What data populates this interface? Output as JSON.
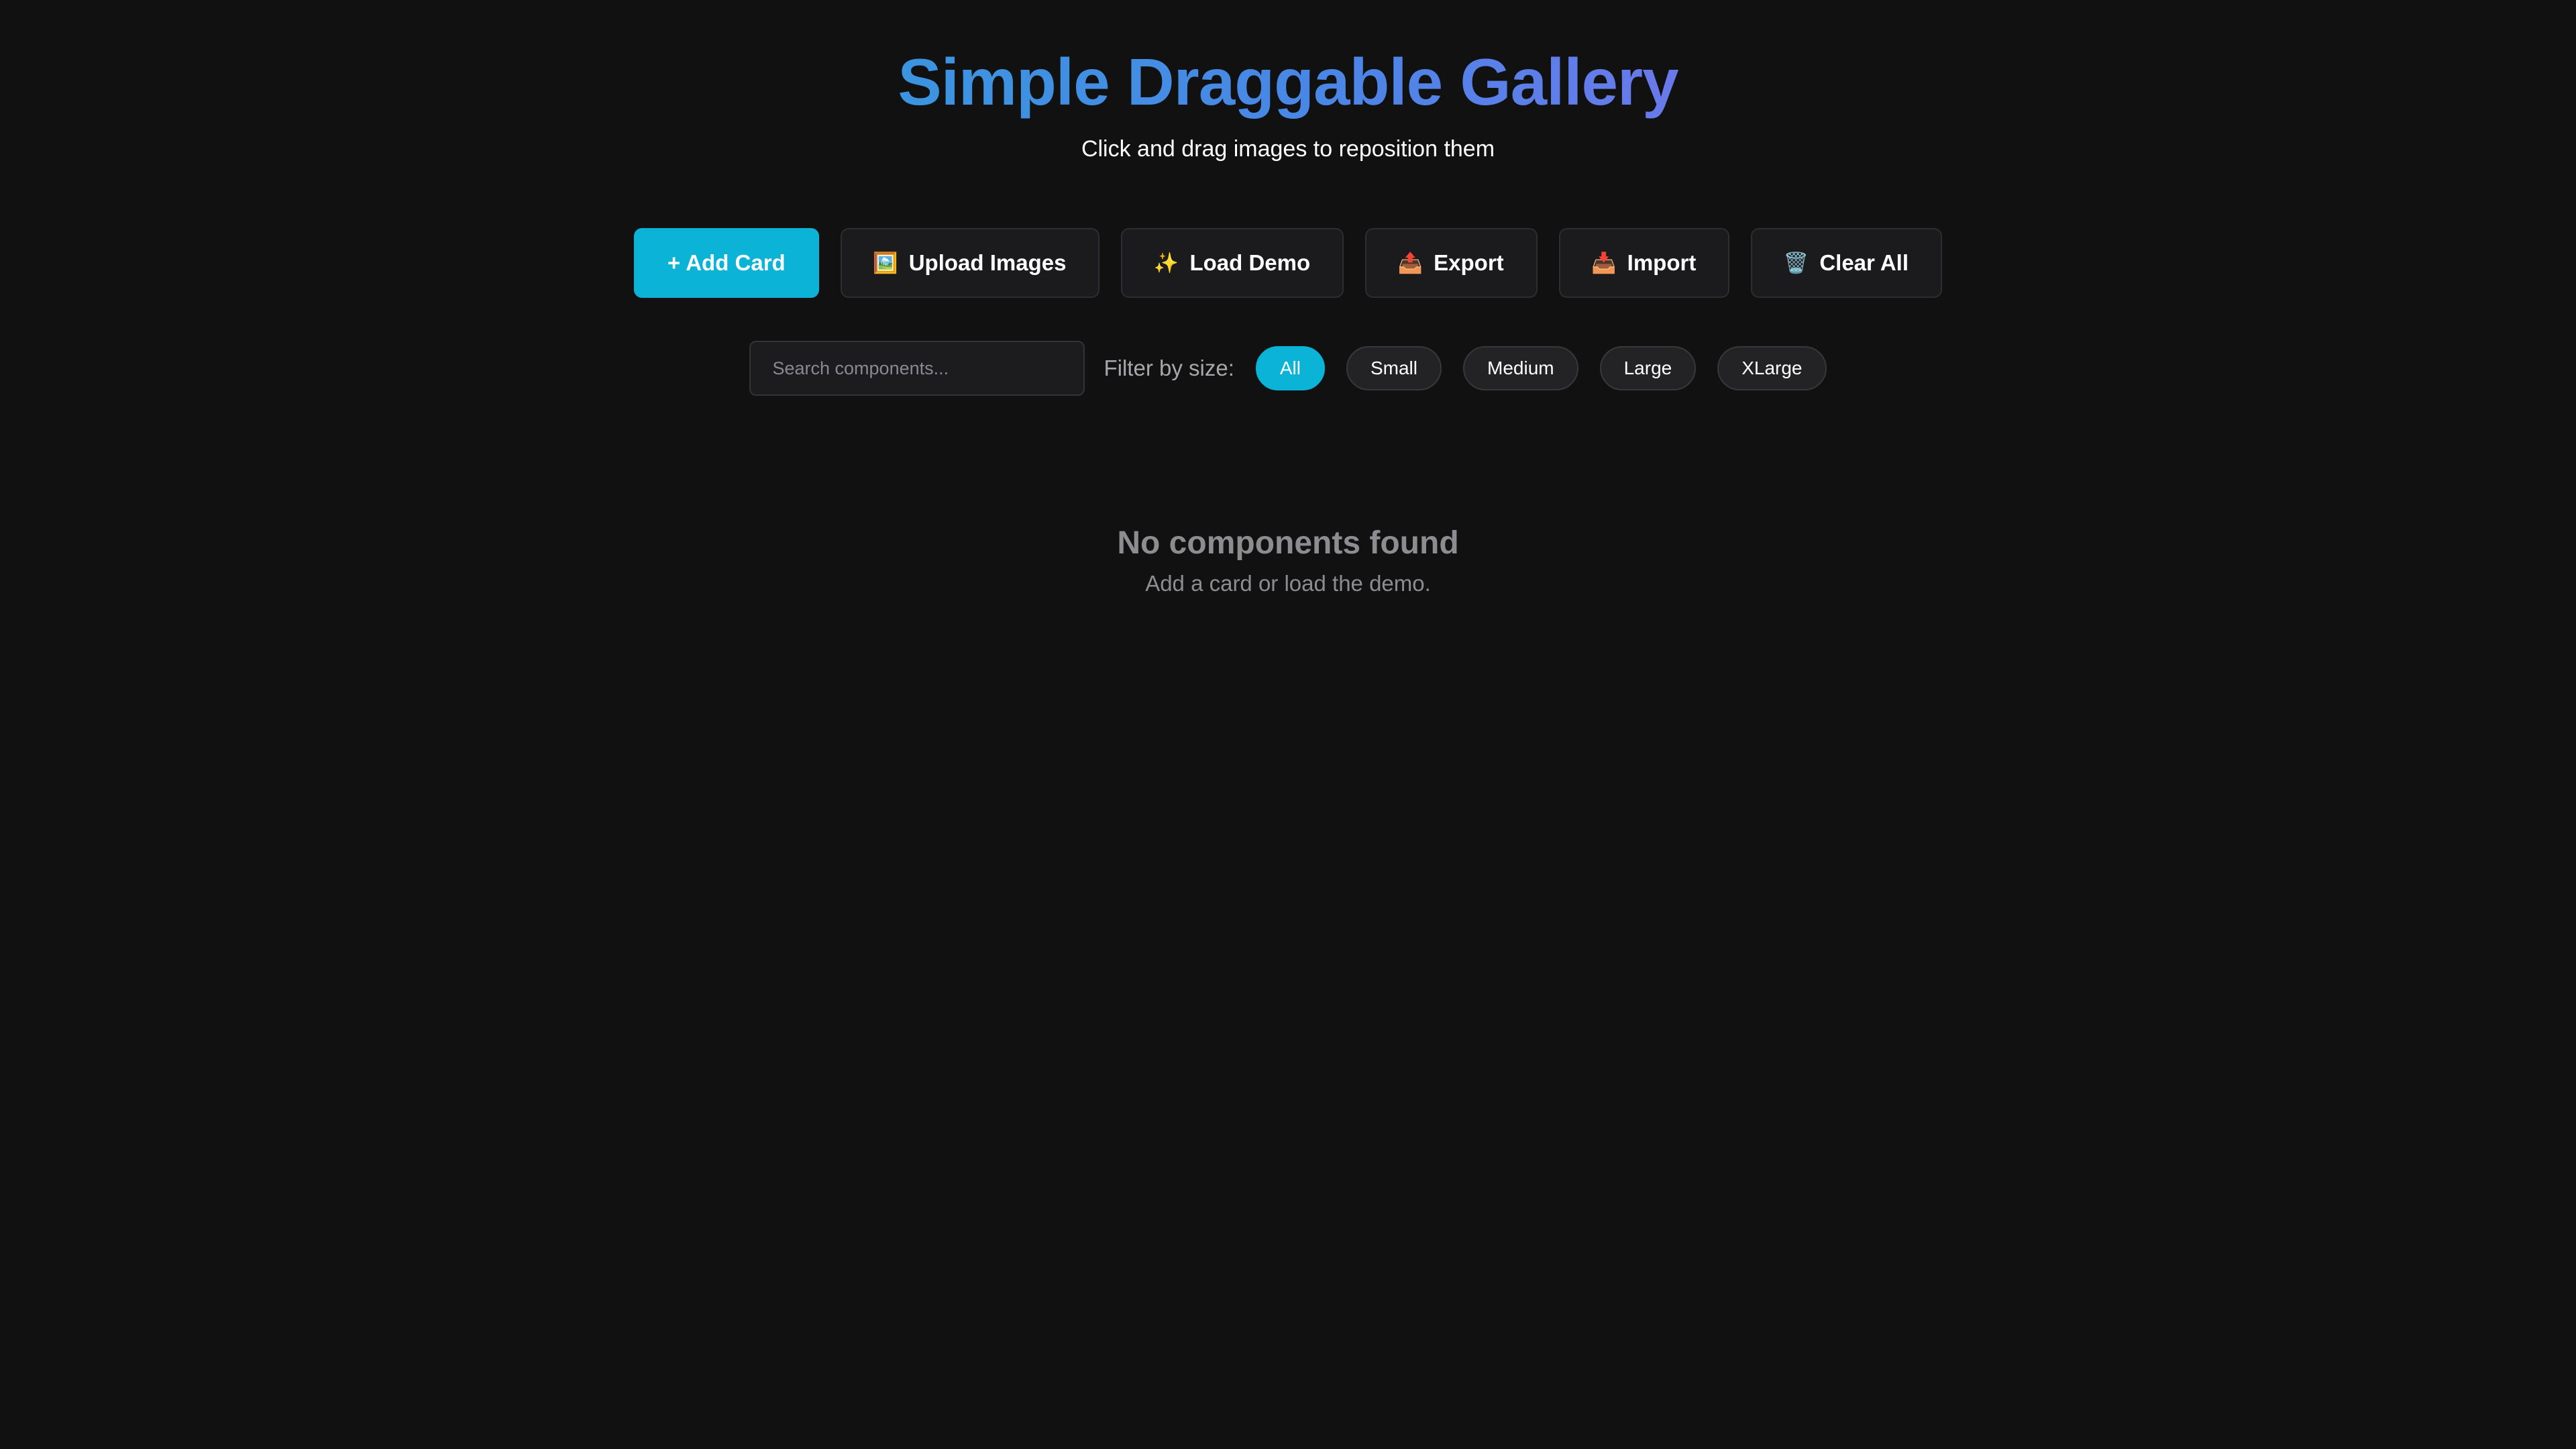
{
  "header": {
    "title": "Simple Draggable Gallery",
    "subtitle": "Click and drag images to reposition them"
  },
  "toolbar": {
    "add_card": {
      "label": "+ Add Card"
    },
    "upload_images": {
      "icon": "🖼️",
      "label": "Upload Images"
    },
    "load_demo": {
      "icon": "✨",
      "label": "Load Demo"
    },
    "export": {
      "icon": "📤",
      "label": "Export"
    },
    "import": {
      "icon": "📥",
      "label": "Import"
    },
    "clear_all": {
      "icon": "🗑️",
      "label": "Clear All"
    }
  },
  "filters": {
    "search_placeholder": "Search components...",
    "search_value": "",
    "label": "Filter by size:",
    "chips": [
      "All",
      "Small",
      "Medium",
      "Large",
      "XLarge"
    ],
    "active": "All"
  },
  "empty_state": {
    "title": "No components found",
    "subtitle": "Add a card or load the demo."
  },
  "colors": {
    "background": "#111111",
    "accent": "#0bb4d6",
    "title_gradient_start": "#3b95e0",
    "title_gradient_end": "#6a79ea",
    "muted_text": "#8d8d91"
  }
}
